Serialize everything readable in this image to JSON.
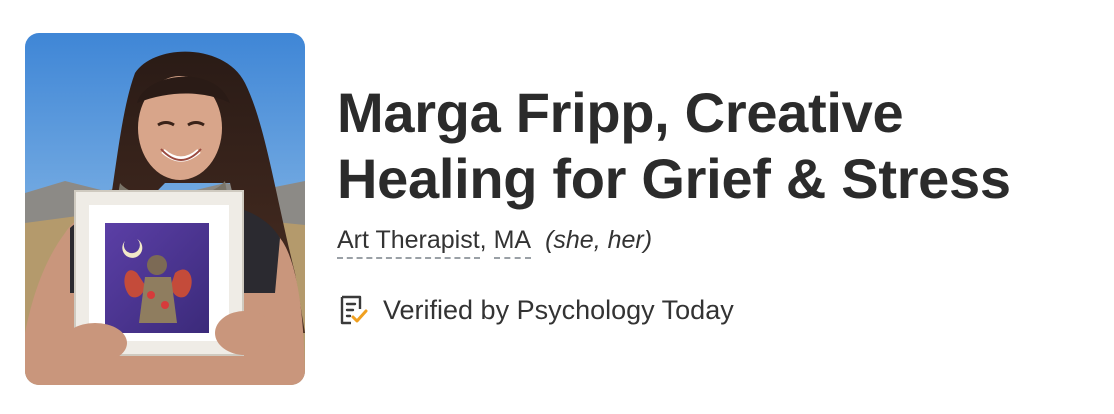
{
  "profile": {
    "name_line1": "Marga Fripp, Creative",
    "name_line2": "Healing for Grief & Stress",
    "title": "Art Therapist",
    "separator": ", ",
    "credential": "MA",
    "pronouns": "(she, her)",
    "verified_text": "Verified by Psychology Today"
  },
  "icons": {
    "verified": "verified-document-check-icon"
  },
  "colors": {
    "text": "#2b2b2b",
    "dashed_underline": "#9aa0a6",
    "check_accent": "#f0a020"
  }
}
